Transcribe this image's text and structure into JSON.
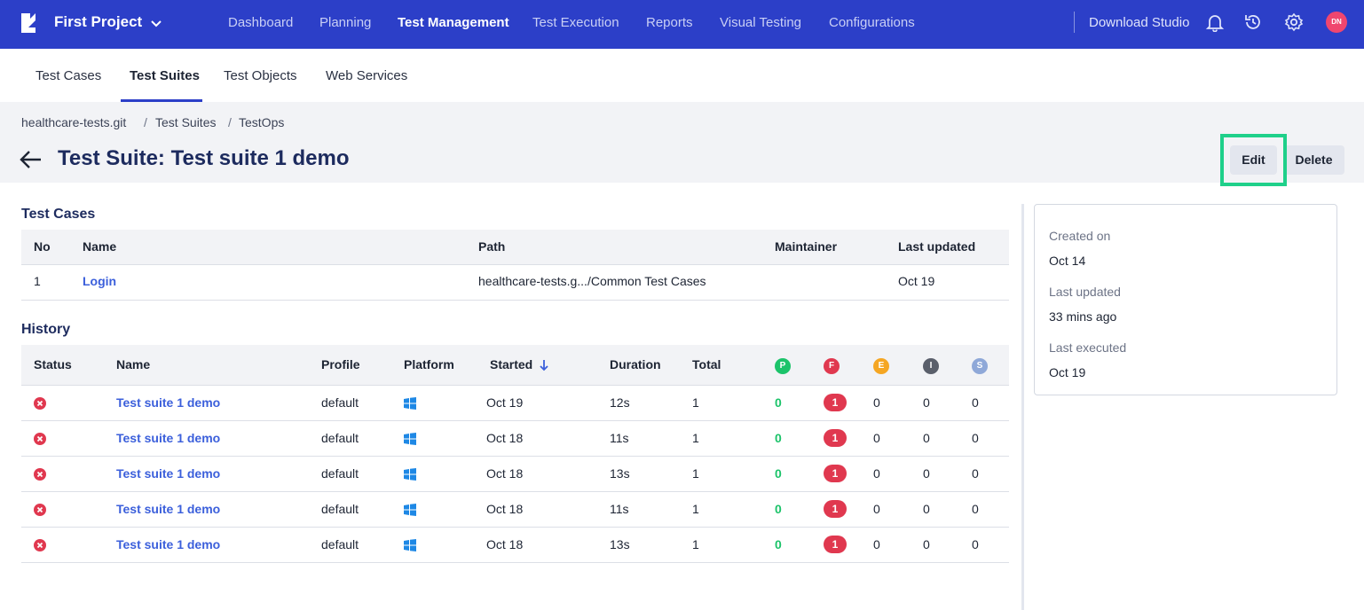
{
  "topnav": {
    "project_name": "First Project",
    "items": [
      "Dashboard",
      "Planning",
      "Test Management",
      "Test Execution",
      "Reports",
      "Visual Testing",
      "Configurations"
    ],
    "active_item": "Test Management",
    "download_studio": "Download Studio",
    "avatar_initials": "DN",
    "icons": [
      "bell-icon",
      "history-icon",
      "gear-icon"
    ],
    "colors": {
      "nav_bg": "#2c3fc8",
      "avatar": "#f0466f"
    }
  },
  "subtabs": {
    "items": [
      "Test Cases",
      "Test Suites",
      "Test Objects",
      "Web Services"
    ],
    "active": "Test Suites"
  },
  "breadcrumb": [
    "healthcare-tests.git",
    "Test Suites",
    "TestOps"
  ],
  "breadcrumb_separator": "/",
  "page": {
    "title": "Test Suite: Test suite 1 demo",
    "edit_label": "Edit",
    "delete_label": "Delete"
  },
  "test_cases": {
    "title": "Test Cases",
    "columns": [
      "No",
      "Name",
      "Path",
      "Maintainer",
      "Last updated"
    ],
    "rows": [
      {
        "no": "1",
        "name": "Login",
        "path": "healthcare-tests.g.../Common Test Cases",
        "maintainer": "",
        "last_updated": "Oct 19"
      }
    ]
  },
  "history": {
    "title": "History",
    "columns": [
      "Status",
      "Name",
      "Profile",
      "Platform",
      "Started",
      "Duration",
      "Total"
    ],
    "status_columns": [
      {
        "letter": "P",
        "color": "#1cc36a"
      },
      {
        "letter": "F",
        "color": "#e0384f"
      },
      {
        "letter": "E",
        "color": "#f5a623"
      },
      {
        "letter": "I",
        "color": "#5a5f6b"
      },
      {
        "letter": "S",
        "color": "#8fa8d8"
      }
    ],
    "rows": [
      {
        "name": "Test suite 1 demo",
        "profile": "default",
        "started": "Oct 19",
        "duration": "12s",
        "total": "1",
        "p": "0",
        "f": "1",
        "e": "0",
        "i": "0",
        "s": "0"
      },
      {
        "name": "Test suite 1 demo",
        "profile": "default",
        "started": "Oct 18",
        "duration": "11s",
        "total": "1",
        "p": "0",
        "f": "1",
        "e": "0",
        "i": "0",
        "s": "0"
      },
      {
        "name": "Test suite 1 demo",
        "profile": "default",
        "started": "Oct 18",
        "duration": "13s",
        "total": "1",
        "p": "0",
        "f": "1",
        "e": "0",
        "i": "0",
        "s": "0"
      },
      {
        "name": "Test suite 1 demo",
        "profile": "default",
        "started": "Oct 18",
        "duration": "11s",
        "total": "1",
        "p": "0",
        "f": "1",
        "e": "0",
        "i": "0",
        "s": "0"
      },
      {
        "name": "Test suite 1 demo",
        "profile": "default",
        "started": "Oct 18",
        "duration": "13s",
        "total": "1",
        "p": "0",
        "f": "1",
        "e": "0",
        "i": "0",
        "s": "0"
      }
    ]
  },
  "info_card": {
    "created_label": "Created on",
    "created_value": "Oct 14",
    "updated_label": "Last updated",
    "updated_value": "33 mins ago",
    "executed_label": "Last executed",
    "executed_value": "Oct 19"
  }
}
